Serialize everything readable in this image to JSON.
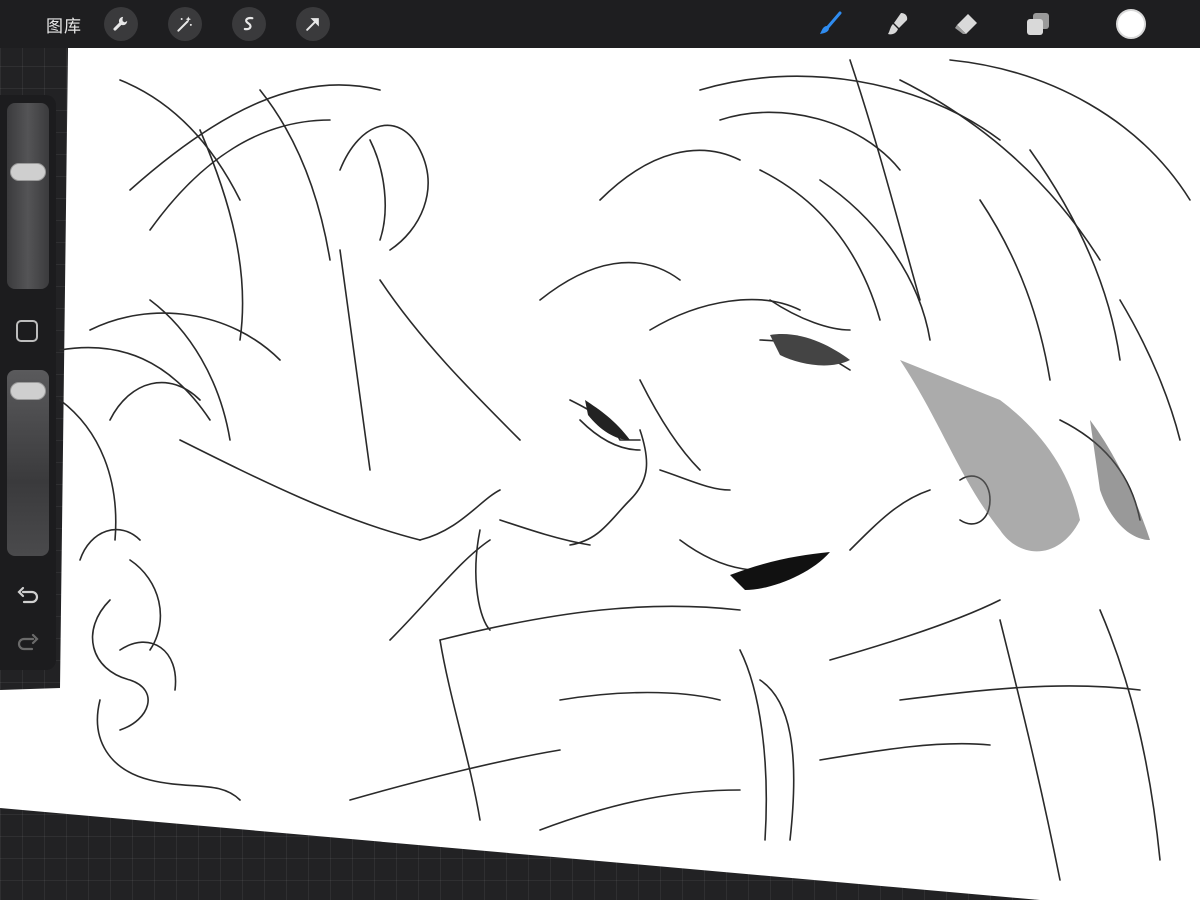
{
  "toolbar": {
    "gallery_label": "图库",
    "left_tools": [
      "wrench-icon",
      "magic-wand-icon",
      "selection-icon",
      "transform-arrow-icon"
    ],
    "right_tools": [
      "brush-icon",
      "smudge-icon",
      "eraser-icon",
      "layers-icon"
    ],
    "active_tool": "brush",
    "accent_color": "#2f8cf0",
    "current_color": "#ffffff"
  },
  "sidebar": {
    "size_slider_value": 0.65,
    "opacity_slider_value": 0.05,
    "buttons": [
      "modify-square-icon",
      "undo-icon",
      "redo-icon"
    ]
  },
  "canvas": {
    "background_color": "#ffffff",
    "content": "pencil-sketch-artwork"
  }
}
